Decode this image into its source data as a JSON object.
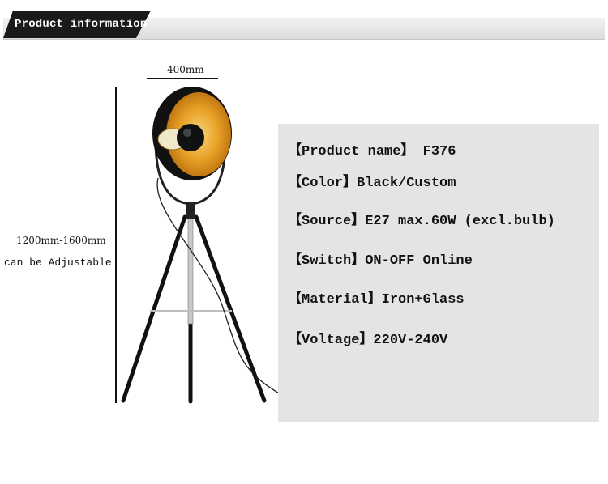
{
  "header": {
    "title": "Product information"
  },
  "dimensions": {
    "width_label": "400mm",
    "height_label": "1200mm-1600mm",
    "adjust_label": "can be Adjustable"
  },
  "specs": [
    "【Product name】 F376",
    "【Color】Black/Custom",
    "【Source】E27 max.60W (excl.bulb)",
    "【Switch】ON-OFF Online",
    "【Material】Iron+Glass",
    "【Voltage】220V-240V"
  ],
  "colors": {
    "header_tab": "#1a1a1a",
    "shade_inner": "#e9a020",
    "panel": "#e4e4e2"
  }
}
